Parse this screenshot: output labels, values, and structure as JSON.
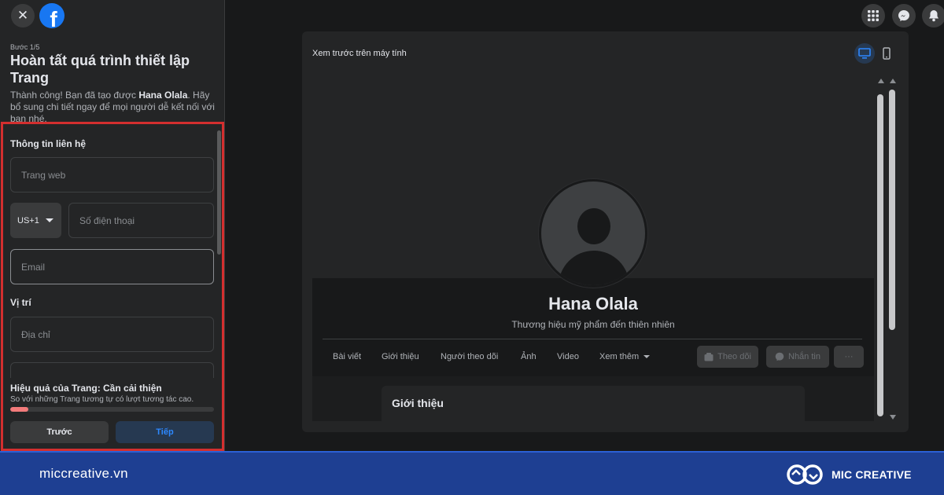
{
  "left_panel": {
    "step": "Bước 1/5",
    "title": "Hoàn tất quá trình thiết lập Trang",
    "desc_before": "Thành công! Bạn đã tạo được ",
    "desc_page_name": "Hana Olala",
    "desc_after": ". Hãy bổ sung chi tiết ngay để mọi người dễ kết nối với bạn nhé.",
    "contact_section": "Thông tin liên hệ",
    "website_placeholder": "Trang web",
    "country_code": "US+1",
    "phone_placeholder": "Số điện thoại",
    "email_placeholder": "Email",
    "location_section": "Vị trí",
    "address_placeholder": "Địa chỉ",
    "performance_title": "Hiệu quả của Trang: Cần cải thiện",
    "performance_desc": "So với những Trang tương tự có lượt tương tác cao.",
    "performance_level": 0.09,
    "prev_button": "Trước",
    "next_button": "Tiếp"
  },
  "preview": {
    "label": "Xem trước trên máy tính",
    "page_name": "Hana Olala",
    "tagline": "Thương hiệu mỹ phẩm đến thiên nhiên",
    "tabs": [
      "Bài viết",
      "Giới thiệu",
      "Người theo dõi",
      "Ảnh",
      "Video",
      "Xem thêm"
    ],
    "follow_button": "Theo dõi",
    "message_button": "Nhắn tin",
    "more_button": "···",
    "intro_title": "Giới thiệu"
  },
  "footer": {
    "url": "miccreative.vn",
    "brand": "MIC CREATIVE"
  },
  "colors": {
    "accent": "#2d88ff",
    "highlight_border": "#d32f2f",
    "footer_bg": "#1e3f92",
    "performance_bar": "#f27b7b"
  },
  "icons": [
    "close-icon",
    "facebook-logo-icon",
    "menu-grid-icon",
    "messenger-icon",
    "notification-bell-icon",
    "desktop-icon",
    "mobile-icon",
    "follow-icon",
    "messenger-small-icon",
    "mic-creative-logo-icon"
  ]
}
